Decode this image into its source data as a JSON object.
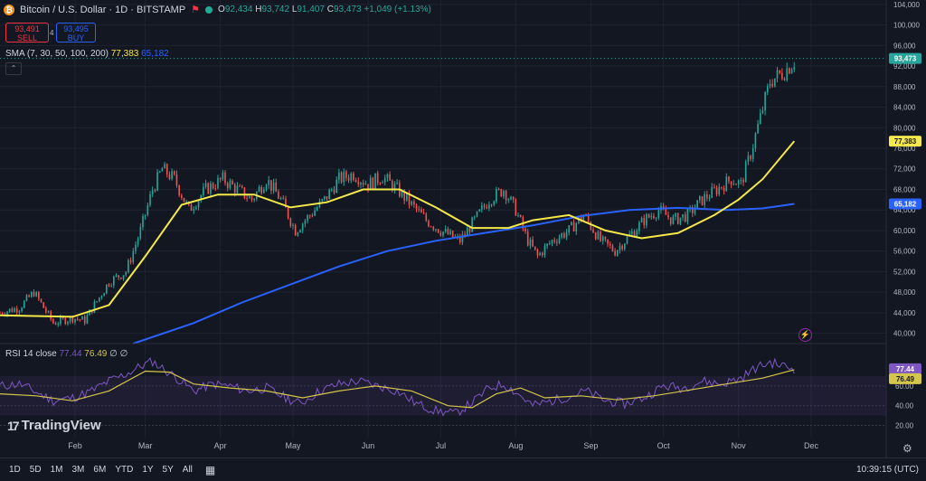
{
  "header": {
    "symbol": "Bitcoin / U.S. Dollar · 1D · BITSTAMP",
    "open_label": "O",
    "open": "92,434",
    "high_label": "H",
    "high": "93,742",
    "low_label": "L",
    "low": "91,407",
    "close_label": "C",
    "close": "93,473",
    "change": "+1,049 (+1.13%)"
  },
  "trade": {
    "sell_price": "93,491",
    "sell_label": "SELL",
    "spread": "4",
    "buy_price": "93,495",
    "buy_label": "BUY"
  },
  "sma_legend": {
    "label": "SMA (7, 30, 50, 100, 200)",
    "v1": "77,383",
    "v2": "65,182"
  },
  "rsi_legend": {
    "label": "RSI 14 close",
    "v1": "77.44",
    "v2": "76.49",
    "extra": "∅ ∅"
  },
  "branding": {
    "name": "TradingView"
  },
  "bottom_bar": {
    "ranges": [
      "1D",
      "5D",
      "1M",
      "3M",
      "6M",
      "YTD",
      "1Y",
      "5Y",
      "All"
    ],
    "clock": "10:39:15 (UTC)"
  },
  "colors": {
    "up": "#26a69a",
    "down": "#ef5350",
    "sma_fast": "#f5e84a",
    "sma_slow": "#2962ff",
    "rsi": "#7e57c2",
    "rsi_ma": "#d4c64a"
  },
  "chart_data": {
    "type": "candlestick",
    "price_axis": {
      "ticks": [
        40000,
        44000,
        48000,
        52000,
        56000,
        60000,
        64000,
        68000,
        72000,
        76000,
        80000,
        84000,
        88000,
        92000,
        96000,
        100000,
        104000
      ],
      "tick_labels": [
        "40,000",
        "44,000",
        "48,000",
        "52,000",
        "56,000",
        "60,000",
        "64,000",
        "68,000",
        "72,000",
        "76,000",
        "80,000",
        "84,000",
        "88,000",
        "92,000",
        "96,000",
        "100,000",
        "104,000"
      ],
      "range": [
        38000,
        104500
      ]
    },
    "time_axis": {
      "labels": [
        "Feb",
        "Mar",
        "Apr",
        "May",
        "Jun",
        "Jul",
        "Aug",
        "Sep",
        "Oct",
        "Nov",
        "Dec"
      ],
      "day_index": [
        31,
        60,
        91,
        121,
        152,
        182,
        213,
        244,
        274,
        305,
        335
      ],
      "range": [
        0,
        366
      ]
    },
    "current_price_label": "93,473",
    "sma_labels": {
      "fast": "77,383",
      "slow": "65,182"
    },
    "price_anchors": [
      [
        0,
        44000
      ],
      [
        8,
        45000
      ],
      [
        14,
        48000
      ],
      [
        22,
        42000
      ],
      [
        30,
        43000
      ],
      [
        35,
        42500
      ],
      [
        45,
        50000
      ],
      [
        52,
        52000
      ],
      [
        58,
        60000
      ],
      [
        63,
        68000
      ],
      [
        67,
        72000
      ],
      [
        72,
        70000
      ],
      [
        78,
        64000
      ],
      [
        85,
        68000
      ],
      [
        92,
        70000
      ],
      [
        98,
        68000
      ],
      [
        104,
        66000
      ],
      [
        110,
        70000
      ],
      [
        116,
        66000
      ],
      [
        122,
        60000
      ],
      [
        128,
        63000
      ],
      [
        134,
        66000
      ],
      [
        140,
        70000
      ],
      [
        146,
        71000
      ],
      [
        152,
        69000
      ],
      [
        158,
        70500
      ],
      [
        164,
        68000
      ],
      [
        170,
        65000
      ],
      [
        176,
        62000
      ],
      [
        182,
        60000
      ],
      [
        190,
        58000
      ],
      [
        196,
        62000
      ],
      [
        202,
        66000
      ],
      [
        208,
        68000
      ],
      [
        213,
        64000
      ],
      [
        218,
        58000
      ],
      [
        222,
        55000
      ],
      [
        228,
        58000
      ],
      [
        235,
        60000
      ],
      [
        241,
        63000
      ],
      [
        248,
        58000
      ],
      [
        254,
        56000
      ],
      [
        260,
        59000
      ],
      [
        266,
        62000
      ],
      [
        272,
        64000
      ],
      [
        278,
        62000
      ],
      [
        284,
        63000
      ],
      [
        290,
        66000
      ],
      [
        296,
        68000
      ],
      [
        302,
        70000
      ],
      [
        306,
        69000
      ],
      [
        310,
        75000
      ],
      [
        314,
        82000
      ],
      [
        318,
        89000
      ],
      [
        324,
        91000
      ],
      [
        328,
        93000
      ]
    ],
    "sma_fast": [
      [
        0,
        43500
      ],
      [
        30,
        43200
      ],
      [
        45,
        45500
      ],
      [
        60,
        55000
      ],
      [
        75,
        65000
      ],
      [
        90,
        67000
      ],
      [
        105,
        67000
      ],
      [
        120,
        64500
      ],
      [
        135,
        65500
      ],
      [
        150,
        68000
      ],
      [
        165,
        68000
      ],
      [
        180,
        64500
      ],
      [
        195,
        60500
      ],
      [
        210,
        60500
      ],
      [
        220,
        62000
      ],
      [
        235,
        63000
      ],
      [
        250,
        60000
      ],
      [
        265,
        58500
      ],
      [
        280,
        59500
      ],
      [
        295,
        63000
      ],
      [
        305,
        66000
      ],
      [
        315,
        70000
      ],
      [
        328,
        77383
      ]
    ],
    "sma_slow": [
      [
        55,
        38000
      ],
      [
        80,
        42000
      ],
      [
        100,
        46000
      ],
      [
        120,
        49500
      ],
      [
        140,
        53000
      ],
      [
        160,
        56000
      ],
      [
        180,
        58000
      ],
      [
        200,
        59500
      ],
      [
        220,
        61000
      ],
      [
        240,
        62800
      ],
      [
        260,
        64000
      ],
      [
        280,
        64400
      ],
      [
        300,
        64000
      ],
      [
        315,
        64300
      ],
      [
        328,
        65182
      ]
    ],
    "rsi_axis": {
      "ticks": [
        20,
        40,
        60
      ],
      "tick_labels": [
        "20.00",
        "40.00",
        "60.00"
      ],
      "range": [
        15,
        92
      ],
      "overbought": 70,
      "oversold": 30
    },
    "rsi_labels": {
      "rsi": "77.44",
      "ma": "76.49"
    },
    "rsi_anchors": [
      [
        0,
        60
      ],
      [
        8,
        62
      ],
      [
        14,
        55
      ],
      [
        22,
        45
      ],
      [
        30,
        48
      ],
      [
        38,
        55
      ],
      [
        45,
        65
      ],
      [
        52,
        72
      ],
      [
        58,
        80
      ],
      [
        63,
        85
      ],
      [
        67,
        78
      ],
      [
        72,
        70
      ],
      [
        80,
        55
      ],
      [
        88,
        62
      ],
      [
        95,
        60
      ],
      [
        102,
        55
      ],
      [
        110,
        58
      ],
      [
        118,
        48
      ],
      [
        124,
        42
      ],
      [
        132,
        55
      ],
      [
        140,
        62
      ],
      [
        148,
        65
      ],
      [
        156,
        60
      ],
      [
        164,
        55
      ],
      [
        172,
        42
      ],
      [
        180,
        35
      ],
      [
        188,
        32
      ],
      [
        196,
        45
      ],
      [
        202,
        58
      ],
      [
        208,
        62
      ],
      [
        214,
        52
      ],
      [
        220,
        40
      ],
      [
        228,
        45
      ],
      [
        236,
        50
      ],
      [
        242,
        55
      ],
      [
        250,
        45
      ],
      [
        258,
        42
      ],
      [
        266,
        48
      ],
      [
        274,
        60
      ],
      [
        282,
        58
      ],
      [
        290,
        65
      ],
      [
        298,
        62
      ],
      [
        306,
        68
      ],
      [
        312,
        78
      ],
      [
        318,
        84
      ],
      [
        324,
        80
      ],
      [
        328,
        77
      ]
    ],
    "rsi_ma": [
      [
        0,
        52
      ],
      [
        15,
        50
      ],
      [
        30,
        45
      ],
      [
        45,
        55
      ],
      [
        60,
        75
      ],
      [
        70,
        74
      ],
      [
        80,
        62
      ],
      [
        95,
        58
      ],
      [
        110,
        55
      ],
      [
        125,
        48
      ],
      [
        140,
        55
      ],
      [
        155,
        60
      ],
      [
        170,
        55
      ],
      [
        185,
        40
      ],
      [
        195,
        38
      ],
      [
        205,
        52
      ],
      [
        215,
        58
      ],
      [
        225,
        48
      ],
      [
        240,
        50
      ],
      [
        255,
        46
      ],
      [
        270,
        50
      ],
      [
        285,
        56
      ],
      [
        300,
        62
      ],
      [
        315,
        68
      ],
      [
        328,
        76.49
      ]
    ]
  }
}
